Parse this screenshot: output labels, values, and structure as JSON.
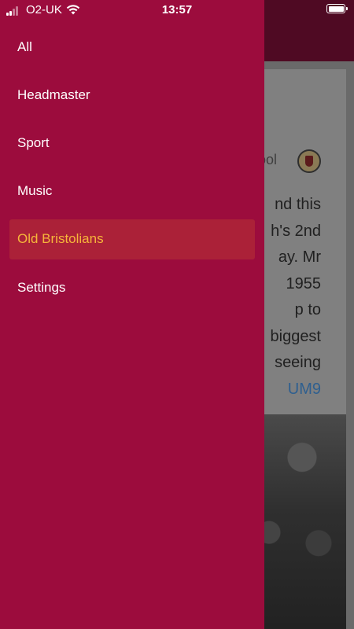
{
  "status_bar": {
    "carrier": "O2-UK",
    "time": "13:57",
    "signal_icon": "signal-strength-icon",
    "wifi_icon": "wifi-icon",
    "battery_icon": "battery-icon"
  },
  "drawer": {
    "items": [
      {
        "label": "All",
        "selected": false
      },
      {
        "label": "Headmaster",
        "selected": false
      },
      {
        "label": "Sport",
        "selected": false
      },
      {
        "label": "Music",
        "selected": false
      },
      {
        "label": "Old Bristolians",
        "selected": true
      },
      {
        "label": "Settings",
        "selected": false
      }
    ]
  },
  "background": {
    "school_name_fragment": "hool",
    "post_lines": [
      "nd this",
      "h's 2nd",
      "ay. Mr",
      "1955",
      "p to",
      "biggest",
      "seeing"
    ],
    "link_fragment": "UM9"
  },
  "colors": {
    "drawer_bg": "#9c0c3d",
    "selected_bg": "#ab2138",
    "selected_text": "#f6b53a",
    "text": "#ffffff"
  }
}
